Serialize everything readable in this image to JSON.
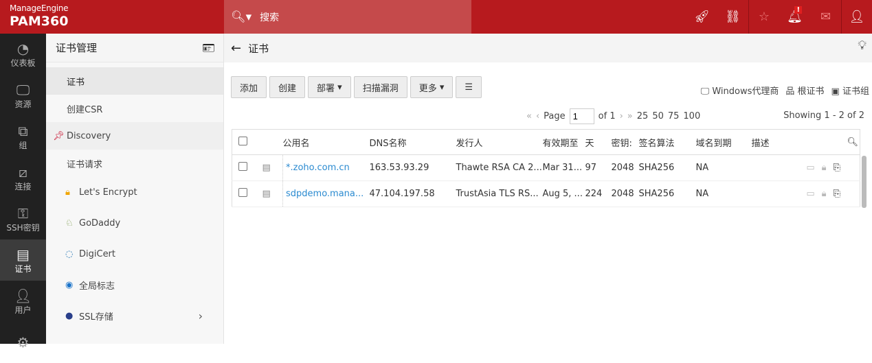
{
  "header": {
    "brand": "ManageEngine",
    "product": "PAM360",
    "search_placeholder": "搜索"
  },
  "nav": [
    {
      "label": "仪表板",
      "icon": "dashboard-icon"
    },
    {
      "label": "资源",
      "icon": "monitor-icon"
    },
    {
      "label": "组",
      "icon": "group-icon"
    },
    {
      "label": "连接",
      "icon": "connection-icon"
    },
    {
      "label": "SSH密钥",
      "icon": "ssh-key-icon"
    },
    {
      "label": "证书",
      "icon": "certificate-icon",
      "active": true
    },
    {
      "label": "用户",
      "icon": "user-icon"
    },
    {
      "label": "",
      "icon": "settings-icon"
    }
  ],
  "sub": {
    "title": "证书管理",
    "items": [
      {
        "label": "证书"
      },
      {
        "label": "创建CSR"
      },
      {
        "label": "Discovery"
      },
      {
        "label": "证书请求"
      },
      {
        "label": "Let's Encrypt"
      },
      {
        "label": "GoDaddy"
      },
      {
        "label": "DigiCert"
      },
      {
        "label": "全局标志"
      },
      {
        "label": "SSL存储"
      }
    ]
  },
  "main": {
    "title": "证书",
    "toolbar": {
      "add": "添加",
      "create": "创建",
      "deploy": "部署",
      "scan": "扫描漏洞",
      "more": "更多"
    },
    "links": {
      "windows": "Windows代理商",
      "root": "根证书",
      "group": "证书组"
    },
    "pagination": {
      "page_label": "Page",
      "page": "1",
      "of": "of 1",
      "sizes": [
        "25",
        "50",
        "75",
        "100"
      ],
      "showing": "Showing 1 - 2 of 2"
    },
    "columns": [
      "公用名",
      "DNS名称",
      "发行人",
      "有效期至",
      "天",
      "密钥:",
      "签名算法",
      "域名到期",
      "描述"
    ],
    "rows": [
      [
        "*.zoho.com.cn",
        "163.53.93.29",
        "Thawte RSA CA 2...",
        "Mar 31...",
        "97",
        "2048",
        "SHA256",
        "NA",
        ""
      ],
      [
        "sdpdemo.mana...",
        "47.104.197.58",
        "TrustAsia TLS RS...",
        "Aug 5, ...",
        "224",
        "2048",
        "SHA256",
        "NA",
        ""
      ]
    ]
  }
}
